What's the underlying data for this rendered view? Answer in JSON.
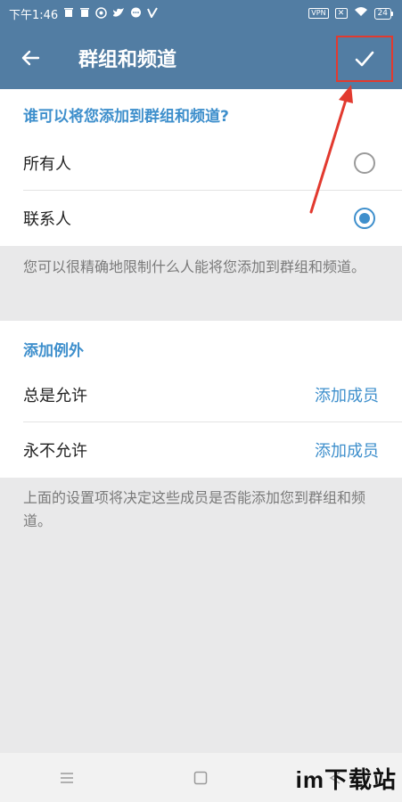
{
  "status_bar": {
    "time": "下午1:46",
    "vpn_label": "VPN",
    "battery_level": "24"
  },
  "header": {
    "title": "群组和频道"
  },
  "who_can_add": {
    "heading": "谁可以将您添加到群组和频道?",
    "options": [
      {
        "label": "所有人",
        "selected": false
      },
      {
        "label": "联系人",
        "selected": true
      }
    ],
    "info": "您可以很精确地限制什么人能将您添加到群组和频道。"
  },
  "exceptions": {
    "heading": "添加例外",
    "rows": [
      {
        "label": "总是允许",
        "action": "添加成员"
      },
      {
        "label": "永不允许",
        "action": "添加成员"
      }
    ],
    "info": "上面的设置项将决定这些成员是否能添加您到群组和频道。"
  },
  "watermark": "im下载站",
  "colors": {
    "accent": "#3e8fcc",
    "appbar": "#527da3",
    "highlight": "#e23a2f"
  },
  "icons": [
    "back-arrow-icon",
    "check-icon",
    "menu-icon",
    "home-icon",
    "back-triangle-icon"
  ]
}
